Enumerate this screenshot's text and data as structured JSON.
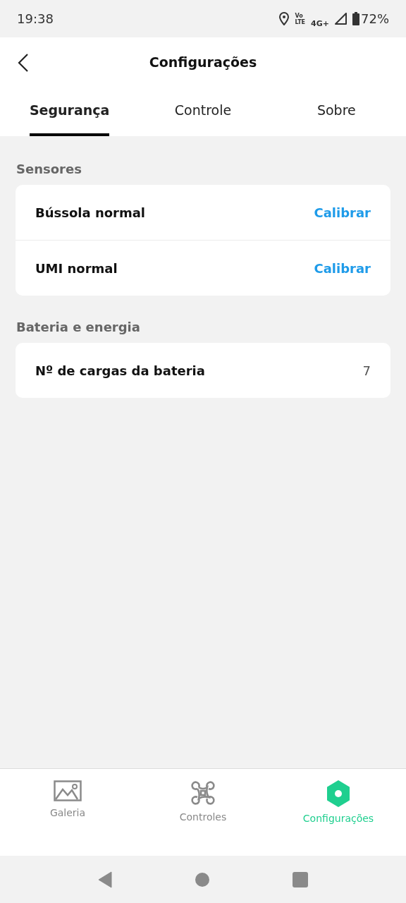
{
  "status_bar": {
    "time": "19:38",
    "volte_top": "Vo",
    "volte_bottom": "LTE",
    "network": "4G+",
    "battery": "72%"
  },
  "header": {
    "title": "Configurações"
  },
  "tabs": [
    {
      "label": "Segurança",
      "selected": true
    },
    {
      "label": "Controle",
      "selected": false
    },
    {
      "label": "Sobre",
      "selected": false
    }
  ],
  "sections": [
    {
      "title": "Sensores",
      "rows": [
        {
          "kind": "action",
          "label": "Bússola normal",
          "action": "Calibrar"
        },
        {
          "kind": "action",
          "label": "UMI normal",
          "action": "Calibrar"
        }
      ]
    },
    {
      "title": "Bateria e energia",
      "rows": [
        {
          "kind": "value",
          "label": "Nº de cargas da bateria",
          "value": "7"
        }
      ]
    }
  ],
  "bottom_nav": [
    {
      "kind": "gallery",
      "label": "Galeria",
      "selected": false
    },
    {
      "kind": "drone",
      "label": "Controles",
      "selected": false
    },
    {
      "kind": "settings",
      "label": "Configurações",
      "selected": true
    }
  ]
}
